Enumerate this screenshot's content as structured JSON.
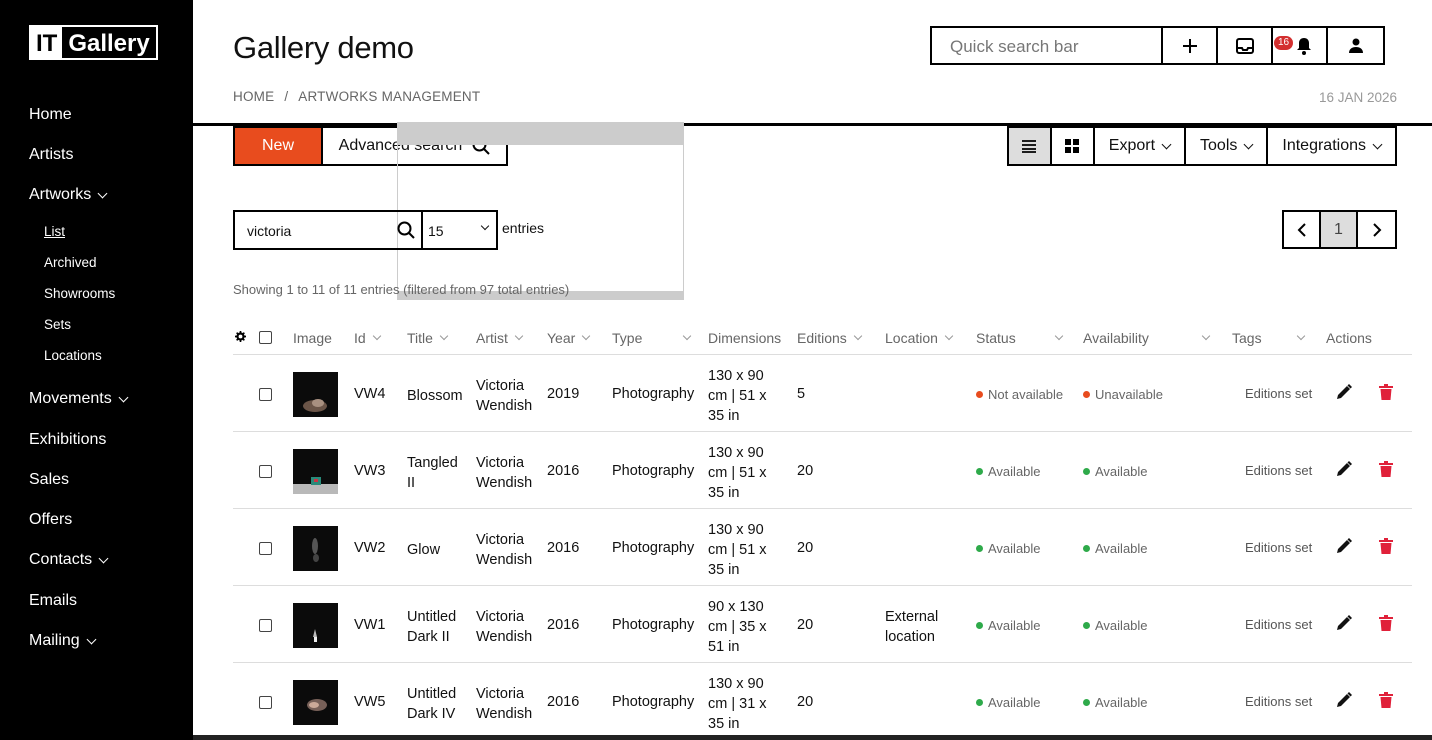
{
  "logo": {
    "part1": "IT",
    "part2": "Gallery"
  },
  "sidebar": {
    "items": [
      {
        "label": "Home"
      },
      {
        "label": "Artists"
      },
      {
        "label": "Artworks"
      },
      {
        "label": "Movements"
      },
      {
        "label": "Exhibitions"
      },
      {
        "label": "Sales"
      },
      {
        "label": "Offers"
      },
      {
        "label": "Contacts"
      },
      {
        "label": "Emails"
      },
      {
        "label": "Mailing"
      }
    ],
    "artworks_sub": [
      {
        "label": "List"
      },
      {
        "label": "Archived"
      },
      {
        "label": "Showrooms"
      },
      {
        "label": "Sets"
      },
      {
        "label": "Locations"
      }
    ]
  },
  "header": {
    "title": "Gallery demo",
    "breadcrumb": [
      "HOME",
      "ARTWORKS MANAGEMENT"
    ],
    "breadcrumb_sep": "/",
    "date": "16 JAN 2026",
    "search_placeholder": "Quick search bar",
    "notifications_count": "16"
  },
  "toolbar": {
    "new_label": "New",
    "advanced_search_label": "Advanced search",
    "export_label": "Export",
    "tools_label": "Tools",
    "integrations_label": "Integrations"
  },
  "filters": {
    "search_value": "victoria",
    "page_size": "15",
    "entries_label": "entries",
    "showing_text": "Showing 1 to 11 of 11 entries (filtered from 97 total entries)",
    "current_page": "1"
  },
  "table": {
    "columns": [
      "Image",
      "Id",
      "Title",
      "Artist",
      "Year",
      "Type",
      "Dimensions",
      "Editions",
      "Location",
      "Status",
      "Availability",
      "Tags",
      "Actions"
    ],
    "rows": [
      {
        "id": "VW4",
        "title": [
          "Blossom"
        ],
        "artist": [
          "Victoria",
          "Wendish"
        ],
        "year": "2019",
        "type": "Photography",
        "dimensions": [
          "130 x 90",
          "cm | 51 x",
          "35 in"
        ],
        "editions": "5",
        "location": [],
        "status": "Not available",
        "status_color": "#e84c1e",
        "availability": "Unavailable",
        "availability_color": "#e84c1e",
        "tags": "Editions set"
      },
      {
        "id": "VW3",
        "title": [
          "Tangled",
          "II"
        ],
        "artist": [
          "Victoria",
          "Wendish"
        ],
        "year": "2016",
        "type": "Photography",
        "dimensions": [
          "130 x 90",
          "cm | 51 x",
          "35 in"
        ],
        "editions": "20",
        "location": [],
        "status": "Available",
        "status_color": "#2eaa4a",
        "availability": "Available",
        "availability_color": "#2eaa4a",
        "tags": "Editions set"
      },
      {
        "id": "VW2",
        "title": [
          "Glow"
        ],
        "artist": [
          "Victoria",
          "Wendish"
        ],
        "year": "2016",
        "type": "Photography",
        "dimensions": [
          "130 x 90",
          "cm | 51 x",
          "35 in"
        ],
        "editions": "20",
        "location": [],
        "status": "Available",
        "status_color": "#2eaa4a",
        "availability": "Available",
        "availability_color": "#2eaa4a",
        "tags": "Editions set"
      },
      {
        "id": "VW1",
        "title": [
          "Untitled",
          "Dark II"
        ],
        "artist": [
          "Victoria",
          "Wendish"
        ],
        "year": "2016",
        "type": "Photography",
        "dimensions": [
          "90 x 130",
          "cm | 35 x",
          "51 in"
        ],
        "editions": "20",
        "location": [
          "External",
          "location"
        ],
        "status": "Available",
        "status_color": "#2eaa4a",
        "availability": "Available",
        "availability_color": "#2eaa4a",
        "tags": "Editions set"
      },
      {
        "id": "VW5",
        "title": [
          "Untitled",
          "Dark IV"
        ],
        "artist": [
          "Victoria",
          "Wendish"
        ],
        "year": "2016",
        "type": "Photography",
        "dimensions": [
          "130 x 90",
          "cm | 31 x",
          "35 in"
        ],
        "editions": "20",
        "location": [],
        "status": "Available",
        "status_color": "#2eaa4a",
        "availability": "Available",
        "availability_color": "#2eaa4a",
        "tags": "Editions set"
      }
    ]
  },
  "icons": {
    "plus": "plus-icon",
    "inbox": "inbox-icon",
    "bell": "bell-icon",
    "user": "user-icon",
    "list_view": "list-view-icon",
    "grid_view": "grid-view-icon",
    "search": "search-icon",
    "edit": "pencil-icon",
    "delete": "trash-icon",
    "settings": "gear-icon"
  }
}
